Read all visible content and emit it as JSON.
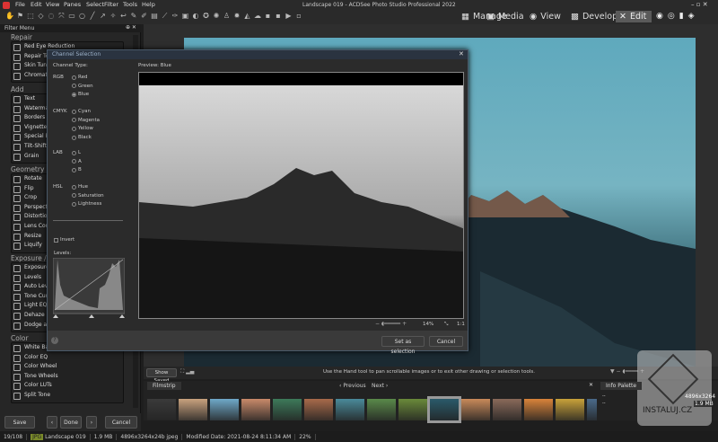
{
  "app": {
    "title": "Landscape 019 - ACDSee Photo Studio Professional 2022"
  },
  "menu": [
    "File",
    "Edit",
    "View",
    "Panes",
    "Select",
    "Filter",
    "Tools",
    "Help"
  ],
  "modes": {
    "manage": "Manage",
    "media": "Media",
    "view": "View",
    "develop": "Develop",
    "edit": "Edit"
  },
  "filter_menu": {
    "title": "Filter Menu",
    "sections": [
      {
        "name": "Repair",
        "items": [
          "Red Eye Reduction",
          "Repair Tool",
          "Skin Tune",
          "Chromatic Aberration"
        ]
      },
      {
        "name": "Add",
        "items": [
          "Text",
          "Watermark",
          "Borders",
          "Vignette",
          "Special Effect",
          "Tilt-Shift",
          "Grain"
        ]
      },
      {
        "name": "Geometry",
        "items": [
          "Rotate",
          "Flip",
          "Crop",
          "Perspective",
          "Distortion",
          "Lens Correction",
          "Resize",
          "Liquify"
        ]
      },
      {
        "name": "Exposure / Lighting",
        "items": [
          "Exposure",
          "Levels",
          "Auto Levels",
          "Tone Curves",
          "Light EQ™",
          "Dehaze",
          "Dodge and Burn"
        ]
      },
      {
        "name": "Color",
        "items": [
          "White Balance",
          "Color EQ",
          "Color Wheel",
          "Tone Wheels",
          "Color LUTs",
          "Split Tone"
        ]
      }
    ]
  },
  "dialog": {
    "title": "Channel Selection",
    "channel_type": "Channel Type:",
    "preview_label": "Preview: Blue",
    "groups": [
      {
        "name": "RGB",
        "options": [
          "Red",
          "Green",
          "Blue"
        ]
      },
      {
        "name": "CMYK",
        "options": [
          "Cyan",
          "Magenta",
          "Yellow",
          "Black"
        ]
      },
      {
        "name": "LAB",
        "options": [
          "L",
          "A",
          "B"
        ]
      },
      {
        "name": "HSL",
        "options": [
          "Hue",
          "Saturation",
          "Lightness"
        ]
      }
    ],
    "selected": "Blue",
    "invert": "Invert",
    "levels": "Levels:",
    "zoom": "14%",
    "one_to_one": "1:1",
    "set_selection": "Set as selection",
    "cancel": "Cancel"
  },
  "strip": {
    "show_saved": "Show Saved",
    "hint": "Use the Hand tool to pan scrollable images or to exit other drawing or selection tools."
  },
  "filmstrip": {
    "title": "Filmstrip",
    "previous": "Previous",
    "next": "Next",
    "thumb_colors": [
      "#3a3a3a",
      "#c9a27e",
      "#6fa9c9",
      "#c98a6a",
      "#3d7a5a",
      "#a86a4a",
      "#4a8a9a",
      "#5a8a4a",
      "#6a8a3a",
      "#2a5a6a",
      "#c98a5a",
      "#8a6a5a",
      "#d9833a",
      "#c9a23a",
      "#4a6a8a"
    ],
    "selected_index": 9
  },
  "info": {
    "title": "Info Palette",
    "dims": "4896x3264",
    "size": "1.9 MB",
    "placeholder": "--"
  },
  "buttons": {
    "save": "Save",
    "done": "Done",
    "cancel": "Cancel"
  },
  "status": {
    "index": "19/108",
    "format": "JPG",
    "name": "Landscape 019",
    "size": "1.9 MB",
    "dims": "4896x3264x24b jpeg",
    "modified": "Modified Date: 2021-08-24 8:11:34 AM",
    "zoom": "22%"
  },
  "watermark": "INSTALUJ.CZ"
}
